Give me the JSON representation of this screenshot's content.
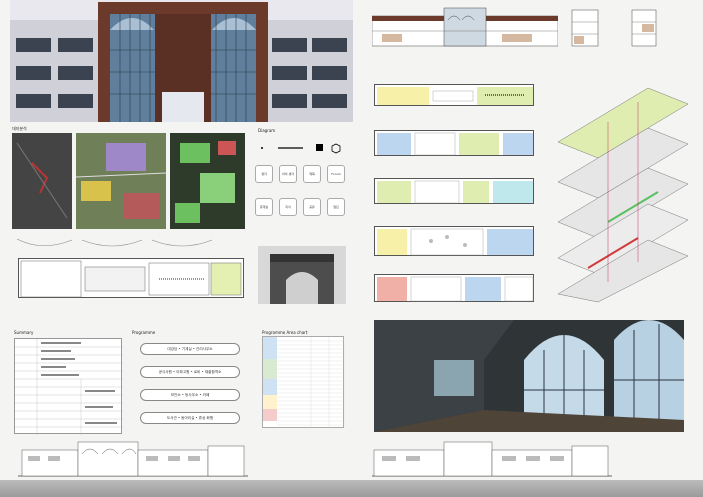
{
  "sections": {
    "site_title": "대지분석",
    "diagram_title": "Diagram",
    "summary_title": "Summary",
    "programme_title": "Programme",
    "area_title": "Programme  Area chart"
  },
  "programme": [
    "대강당 • 기계실 • 관리사무소",
    "공식사원 • 아파고원 • 로비 • 제출합격소",
    "보안소 • 등사무소 • 카페",
    "도서관 • 동아리실 • 휴상 화원"
  ],
  "diagram_icons": [
    "생각",
    "아이 생각",
    "제목",
    "Forum",
    "휴게실",
    "지식",
    "공유",
    "열린"
  ],
  "colors": {
    "brick": "#6b3a2a",
    "glass": "#5f7f9c",
    "plan_green": "#dfeeb0",
    "plan_blue": "#bcd6f0",
    "plan_red": "#f0b0a8",
    "plan_yellow": "#f6f0a8",
    "render_dark": "#2f3436"
  }
}
